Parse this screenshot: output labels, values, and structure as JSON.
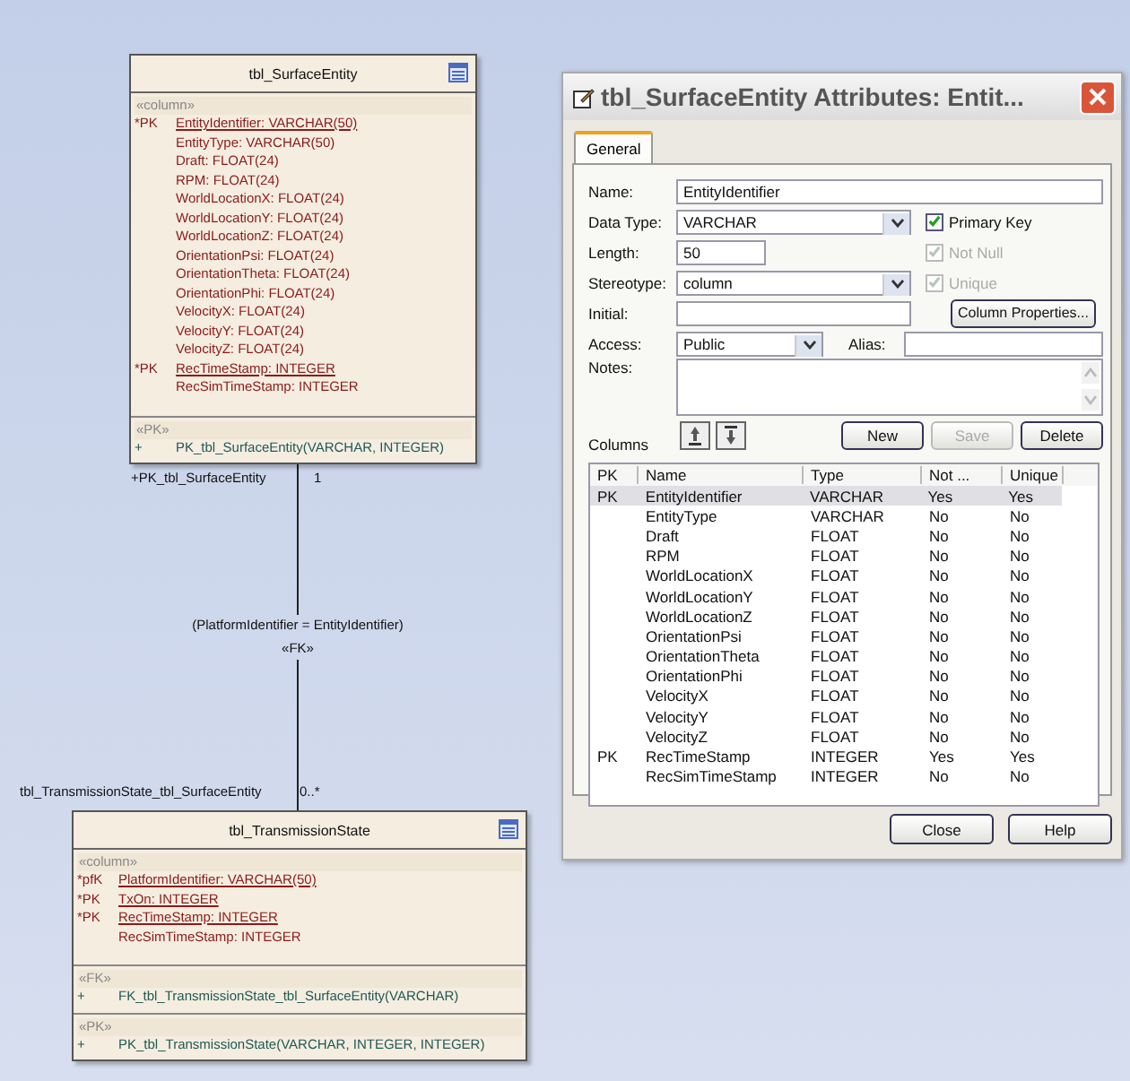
{
  "entities": [
    {
      "title": "tbl_SurfaceEntity",
      "sections": [
        {
          "kind": "column",
          "stereotype": "«column»",
          "members": [
            {
              "prefix": "*PK",
              "text": "EntityIdentifier:  VARCHAR(50)",
              "key": true
            },
            {
              "text": "EntityType:  VARCHAR(50)",
              "key": false
            },
            {
              "text": "Draft:  FLOAT(24)",
              "key": false
            },
            {
              "text": "RPM:  FLOAT(24)",
              "key": false
            },
            {
              "text": "WorldLocationX:  FLOAT(24)",
              "key": false
            },
            {
              "text": "WorldLocationY:  FLOAT(24)",
              "key": false
            },
            {
              "text": "WorldLocationZ:  FLOAT(24)",
              "key": false
            },
            {
              "text": "OrientationPsi:  FLOAT(24)",
              "key": false
            },
            {
              "text": "OrientationTheta:  FLOAT(24)",
              "key": false
            },
            {
              "text": "OrientationPhi:  FLOAT(24)",
              "key": false
            },
            {
              "text": "VelocityX:  FLOAT(24)",
              "key": false
            },
            {
              "text": "VelocityY:  FLOAT(24)",
              "key": false
            },
            {
              "text": "VelocityZ:  FLOAT(24)",
              "key": false
            },
            {
              "prefix": "*PK",
              "text": "RecTimeStamp:  INTEGER",
              "key": true
            },
            {
              "text": "RecSimTimeStamp:  INTEGER",
              "key": false
            }
          ]
        },
        {
          "kind": "operation",
          "stereotype": "«PK»",
          "members": [
            {
              "prefix": "+",
              "text": "PK_tbl_SurfaceEntity(VARCHAR, INTEGER)"
            }
          ]
        }
      ]
    },
    {
      "title": "tbl_TransmissionState",
      "sections": [
        {
          "kind": "column",
          "stereotype": "«column»",
          "members": [
            {
              "prefix": "*pfK",
              "text": "PlatformIdentifier:  VARCHAR(50)",
              "key": true
            },
            {
              "prefix": "*PK",
              "text": "TxOn:  INTEGER",
              "key": true
            },
            {
              "prefix": "*PK",
              "text": "RecTimeStamp:  INTEGER",
              "key": true
            },
            {
              "text": "RecSimTimeStamp:  INTEGER",
              "key": false
            }
          ]
        },
        {
          "kind": "operation",
          "stereotype": "«FK»",
          "members": [
            {
              "prefix": "+",
              "text": "FK_tbl_TransmissionState_tbl_SurfaceEntity(VARCHAR)"
            }
          ]
        },
        {
          "kind": "operation",
          "stereotype": "«PK»",
          "members": [
            {
              "prefix": "+",
              "text": "PK_tbl_TransmissionState(VARCHAR, INTEGER, INTEGER)"
            }
          ]
        }
      ]
    }
  ],
  "connector": {
    "source_role": "+PK_tbl_SurfaceEntity",
    "source_multiplicity": "1",
    "constraint": "(PlatformIdentifier = EntityIdentifier)",
    "stereotype": "«FK»",
    "target_role": "tbl_TransmissionState_tbl_SurfaceEntity",
    "target_multiplicity": "0..*"
  },
  "dialog": {
    "title": "tbl_SurfaceEntity Attributes: Entit...",
    "tabs": [
      {
        "label": "General",
        "selected": true
      }
    ],
    "name": {
      "label": "Name:",
      "value": "EntityIdentifier"
    },
    "data_type": {
      "label": "Data Type:",
      "value": "VARCHAR"
    },
    "length": {
      "label": "Length:",
      "value": "50"
    },
    "stereotype": {
      "label": "Stereotype:",
      "value": "column"
    },
    "initial": {
      "label": "Initial:"
    },
    "access": {
      "label": "Access:",
      "value": "Public"
    },
    "alias": {
      "label": "Alias:"
    },
    "notes": {
      "label": "Notes:"
    },
    "checkboxes": [
      {
        "label": "Primary Key",
        "checked": true,
        "disabled": false
      },
      {
        "label": "Not Null",
        "checked": true,
        "disabled": true
      },
      {
        "label": "Unique",
        "checked": true,
        "disabled": true
      }
    ],
    "column_properties_button": "Column Properties...",
    "columns_label": "Columns",
    "column_buttons": [
      {
        "label": "New",
        "disabled": false
      },
      {
        "label": "Save",
        "disabled": true
      },
      {
        "label": "Delete",
        "disabled": false
      }
    ],
    "table": {
      "columns": [
        "PK",
        "Name",
        "Type",
        "Not ...",
        "Unique"
      ],
      "rows": [
        {
          "cells": [
            "PK",
            "EntityIdentifier",
            "VARCHAR",
            "Yes",
            "Yes"
          ],
          "selected": true
        },
        {
          "cells": [
            null,
            "EntityType",
            "VARCHAR",
            "No",
            "No"
          ],
          "selected": false
        },
        {
          "cells": [
            null,
            "Draft",
            "FLOAT",
            "No",
            "No"
          ],
          "selected": false
        },
        {
          "cells": [
            null,
            "RPM",
            "FLOAT",
            "No",
            "No"
          ],
          "selected": false
        },
        {
          "cells": [
            null,
            "WorldLocationX",
            "FLOAT",
            "No",
            "No"
          ],
          "selected": false
        },
        {
          "cells": [
            null,
            "WorldLocationY",
            "FLOAT",
            "No",
            "No"
          ],
          "selected": false
        },
        {
          "cells": [
            null,
            "WorldLocationZ",
            "FLOAT",
            "No",
            "No"
          ],
          "selected": false
        },
        {
          "cells": [
            null,
            "OrientationPsi",
            "FLOAT",
            "No",
            "No"
          ],
          "selected": false
        },
        {
          "cells": [
            null,
            "OrientationTheta",
            "FLOAT",
            "No",
            "No"
          ],
          "selected": false
        },
        {
          "cells": [
            null,
            "OrientationPhi",
            "FLOAT",
            "No",
            "No"
          ],
          "selected": false
        },
        {
          "cells": [
            null,
            "VelocityX",
            "FLOAT",
            "No",
            "No"
          ],
          "selected": false
        },
        {
          "cells": [
            null,
            "VelocityY",
            "FLOAT",
            "No",
            "No"
          ],
          "selected": false
        },
        {
          "cells": [
            null,
            "VelocityZ",
            "FLOAT",
            "No",
            "No"
          ],
          "selected": false
        },
        {
          "cells": [
            "PK",
            "RecTimeStamp",
            "INTEGER",
            "Yes",
            "Yes"
          ],
          "selected": false
        },
        {
          "cells": [
            null,
            "RecSimTimeStamp",
            "INTEGER",
            "No",
            "No"
          ],
          "selected": false
        }
      ]
    },
    "buttons": [
      "Close",
      "Help"
    ]
  }
}
